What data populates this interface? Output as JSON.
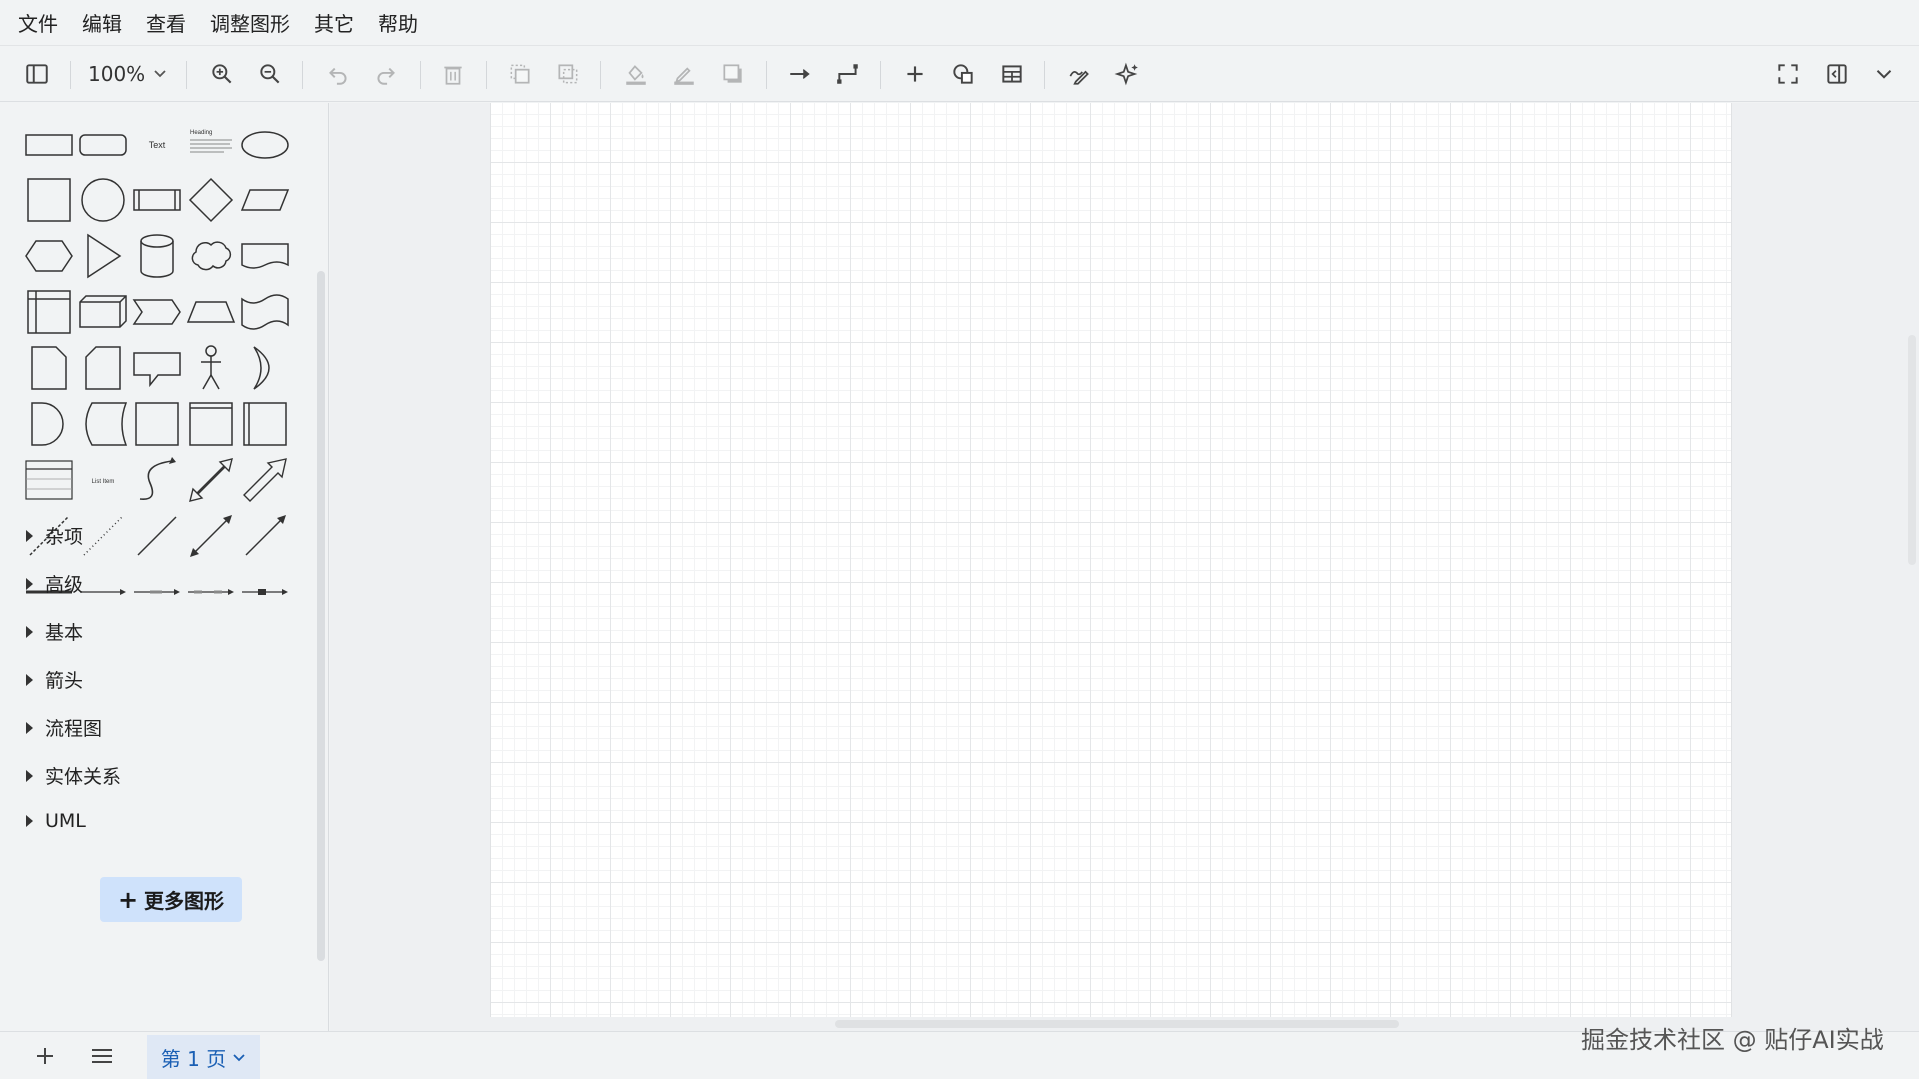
{
  "menubar": {
    "items": [
      "文件",
      "编辑",
      "查看",
      "调整图形",
      "其它",
      "帮助"
    ]
  },
  "toolbar": {
    "zoom_level": "100%",
    "icons": [
      "sidebar-toggle-icon",
      "zoom-in-icon",
      "zoom-out-icon",
      "undo-icon",
      "redo-icon",
      "delete-icon",
      "to-front-icon",
      "to-back-icon",
      "fill-color-icon",
      "line-color-icon",
      "shadow-icon",
      "connection-icon",
      "waypoints-icon",
      "insert-icon",
      "shapes-icon",
      "table-icon",
      "freehand-icon",
      "ai-generate-icon",
      "fullscreen-icon",
      "format-panel-icon",
      "expand-icon"
    ]
  },
  "sidebar": {
    "shape_labels": {
      "text": "Text",
      "heading": "Heading",
      "list_item": "List Item"
    },
    "categories": [
      "杂项",
      "高级",
      "基本",
      "箭头",
      "流程图",
      "实体关系",
      "UML"
    ],
    "more_shapes_label": "更多图形",
    "more_shapes_plus": "+"
  },
  "bottombar": {
    "page_tab_label": "第 1 页"
  },
  "watermark": "掘金技术社区 @ 贴仔AI实战"
}
